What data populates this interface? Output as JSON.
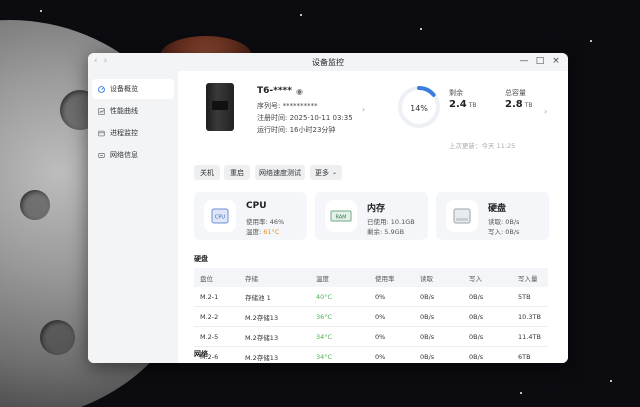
{
  "window": {
    "title": "设备监控",
    "close": "×",
    "maximize": "□",
    "minimize": "—",
    "back": "‹",
    "forward": "›"
  },
  "sidebar": {
    "items": [
      {
        "label": "设备概览",
        "icon": "dashboard-icon",
        "active": true
      },
      {
        "label": "性能曲线",
        "icon": "chart-icon",
        "active": false
      },
      {
        "label": "进程监控",
        "icon": "process-icon",
        "active": false
      },
      {
        "label": "网络信息",
        "icon": "network-icon",
        "active": false
      }
    ]
  },
  "device": {
    "name": "T6-****",
    "serial_label": "序列号:",
    "serial_value": "**********",
    "register_label": "注册时间:",
    "register_value": "2025-10-11 03:35",
    "uptime_label": "运行时间:",
    "uptime_value": "16小时23分钟"
  },
  "storage": {
    "used_percent_text": "14%",
    "used_fraction": 0.14,
    "remaining_label": "剩余",
    "remaining_value": "2.4",
    "remaining_unit": "TB",
    "total_label": "总容量",
    "total_value": "2.8",
    "total_unit": "TB",
    "updated": "上次更新：今天 11:25"
  },
  "actions": {
    "shutdown": "关机",
    "reboot": "重启",
    "speedtest": "网络速度测试",
    "more": "更多"
  },
  "cards": {
    "cpu": {
      "title": "CPU",
      "icon_text": "CPU",
      "line1": "使用率: 46%",
      "line2_label": "温度: ",
      "line2_value": "61°C"
    },
    "memory": {
      "title": "内存",
      "icon_text": "RAM",
      "line1": "已使用: 10.1GB",
      "line2": "剩余: 5.9GB"
    },
    "disk": {
      "title": "硬盘",
      "line1": "读取: 0B/s",
      "line2": "写入: 0B/s"
    }
  },
  "disk_section": {
    "title": "硬盘",
    "columns": [
      "盘位",
      "存储",
      "温度",
      "使用率",
      "读取",
      "写入",
      "写入量"
    ],
    "rows": [
      [
        "M.2-1",
        "存储池 1",
        "40°C",
        "0%",
        "0B/s",
        "0B/s",
        "5TB"
      ],
      [
        "M.2-2",
        "M.2存储13",
        "36°C",
        "0%",
        "0B/s",
        "0B/s",
        "10.3TB"
      ],
      [
        "M.2-5",
        "M.2存储13",
        "34°C",
        "0%",
        "0B/s",
        "0B/s",
        "11.4TB"
      ],
      [
        "M.2-6",
        "M.2存储13",
        "34°C",
        "0%",
        "0B/s",
        "0B/s",
        "6TB"
      ]
    ]
  },
  "network_section": {
    "title": "网络"
  },
  "colors": {
    "accent": "#3b7ddd",
    "temp_warn": "#f08a24",
    "temp_ok": "#4caf50"
  }
}
